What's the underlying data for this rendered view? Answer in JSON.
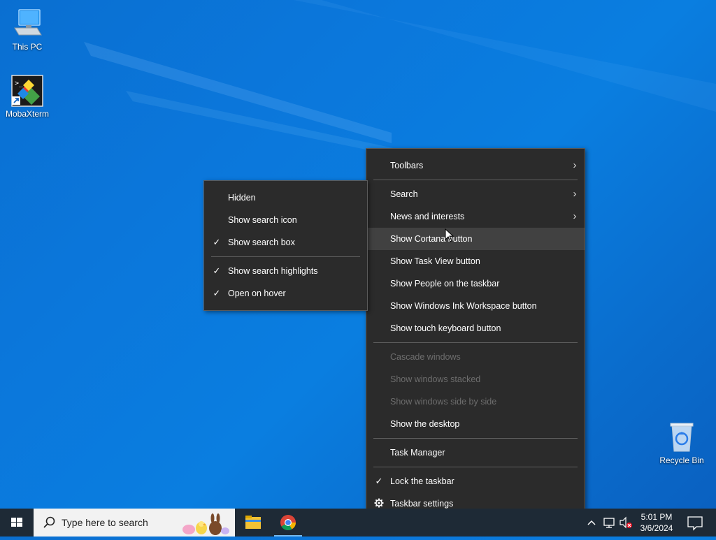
{
  "desktop": {
    "icons": [
      {
        "label": "This PC",
        "icon": "computer-icon"
      },
      {
        "label": "MobaXterm",
        "icon": "mobaxterm-icon"
      },
      {
        "label": "Recycle Bin",
        "icon": "recycle-bin-icon"
      }
    ]
  },
  "taskbar_menu": {
    "items": [
      {
        "label": "Toolbars",
        "submenu": true
      },
      {
        "label": "Search",
        "submenu": true
      },
      {
        "label": "News and interests",
        "submenu": true
      },
      {
        "label": "Show Cortana button",
        "highlighted": true
      },
      {
        "label": "Show Task View button"
      },
      {
        "label": "Show People on the taskbar"
      },
      {
        "label": "Show Windows Ink Workspace button"
      },
      {
        "label": "Show touch keyboard button"
      },
      {
        "label": "Cascade windows",
        "disabled": true
      },
      {
        "label": "Show windows stacked",
        "disabled": true
      },
      {
        "label": "Show windows side by side",
        "disabled": true
      },
      {
        "label": "Show the desktop"
      },
      {
        "label": "Task Manager"
      },
      {
        "label": "Lock the taskbar",
        "checked": true
      },
      {
        "label": "Taskbar settings",
        "icon": "gear-icon"
      }
    ]
  },
  "search_submenu": {
    "items": [
      {
        "label": "Hidden"
      },
      {
        "label": "Show search icon"
      },
      {
        "label": "Show search box",
        "checked": true
      },
      {
        "label": "Show search highlights",
        "checked": true
      },
      {
        "label": "Open on hover",
        "checked": true
      }
    ]
  },
  "taskbar": {
    "search_placeholder": "Type here to search",
    "pinned": [
      {
        "icon": "file-explorer-icon"
      },
      {
        "icon": "chrome-icon",
        "active": true
      }
    ],
    "clock": {
      "time": "5:01 PM",
      "date": "3/6/2024"
    }
  },
  "colors": {
    "menu_bg": "#2b2b2b",
    "menu_hover": "#414141",
    "taskbar_bg": "#1e2a36",
    "wallpaper": "#0a77db"
  }
}
